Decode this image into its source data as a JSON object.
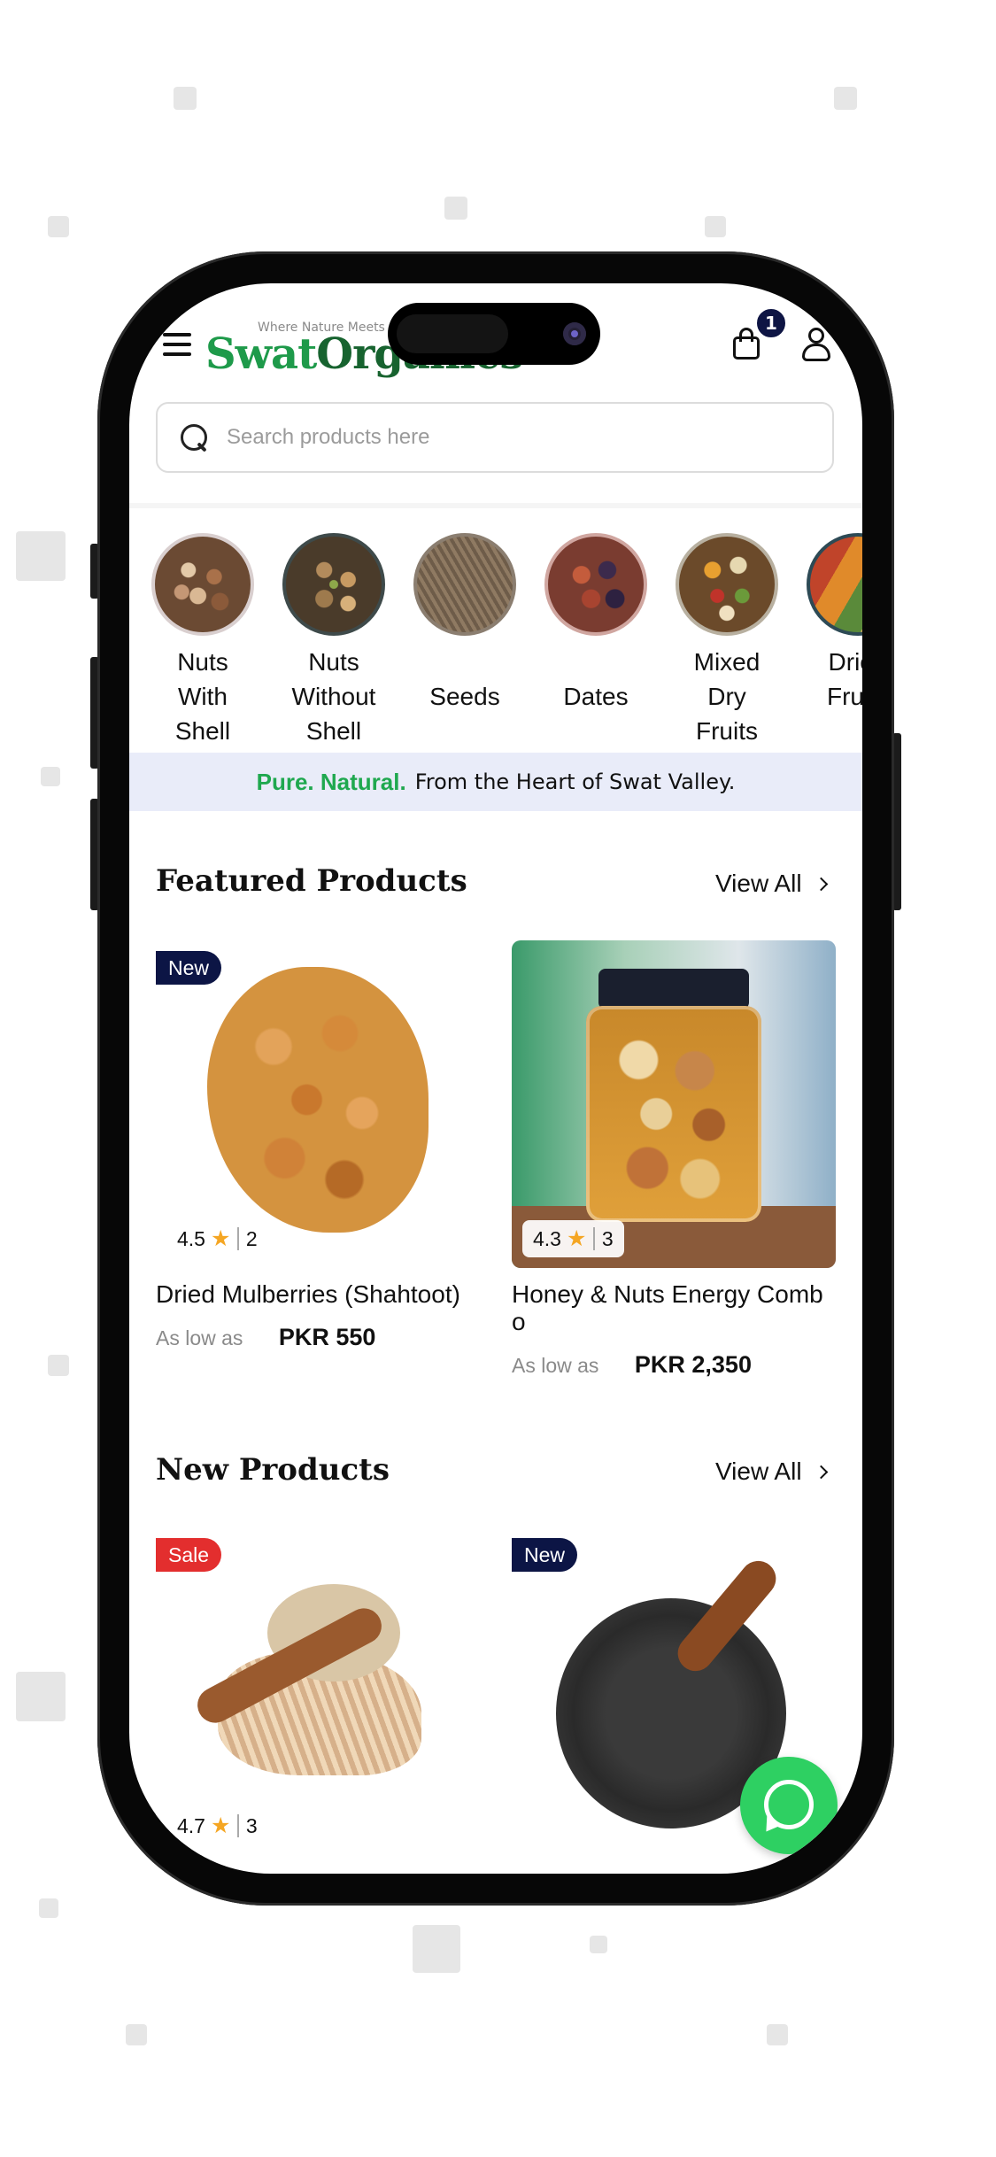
{
  "header": {
    "logo_tagline": "Where Nature Meets",
    "logo_part1": "Swat",
    "logo_part2": "Organics",
    "cart_count": "1"
  },
  "search": {
    "placeholder": "Search products here"
  },
  "categories": [
    {
      "label": "Nuts With Shell",
      "icon": "mixed-nuts-bowl"
    },
    {
      "label": "Nuts Without Shell",
      "icon": "pistachios-bowl"
    },
    {
      "label": "Seeds",
      "icon": "seeds-bowl"
    },
    {
      "label": "Dates",
      "icon": "dates-bowl"
    },
    {
      "label": "Mixed Dry Fruits",
      "icon": "dry-fruits-bowl"
    },
    {
      "label": "Dried Fruits",
      "icon": "dried-fruits-bowl"
    }
  ],
  "banner": {
    "highlight": "Pure. Natural.",
    "text": "From the Heart of Swat Valley."
  },
  "featured": {
    "title": "Featured Products",
    "view_all": "View All",
    "products": [
      {
        "name": "Dried Mulberries (Shahtoot)",
        "badge": "New",
        "rating": "4.5",
        "reviews": "2",
        "as_low_as": "As low as",
        "price": "PKR 550"
      },
      {
        "name": "Honey & Nuts Energy Combo",
        "badge": "",
        "rating": "4.3",
        "reviews": "3",
        "as_low_as": "As low as",
        "price": "PKR 2,350"
      }
    ]
  },
  "new_products": {
    "title": "New Products",
    "view_all": "View All",
    "products": [
      {
        "name": "…",
        "badge": "Sale",
        "rating": "4.7",
        "reviews": "3"
      },
      {
        "name": "…",
        "badge": "New"
      }
    ]
  },
  "colors": {
    "brand_green": "#1e9a4a",
    "navy": "#0c1545",
    "sale_red": "#e32e2e",
    "whatsapp": "#2ed062",
    "star": "#f5a623"
  }
}
